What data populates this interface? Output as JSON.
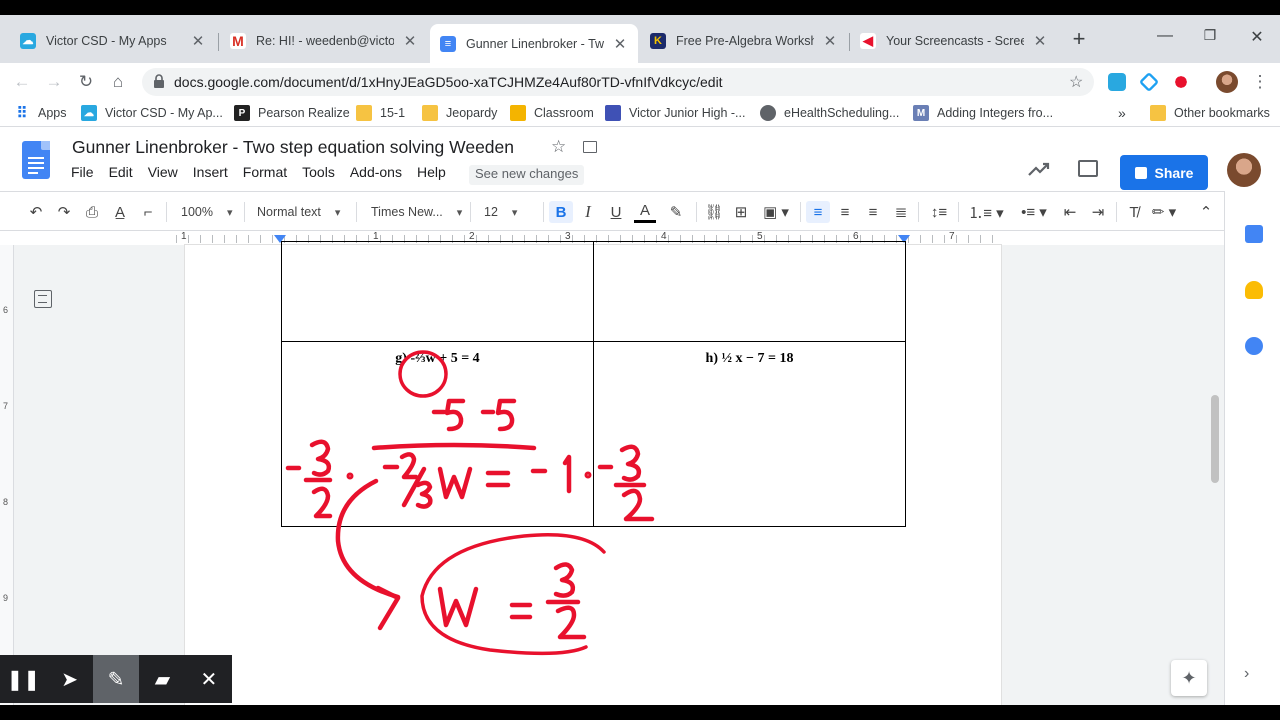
{
  "browser": {
    "tabs": [
      {
        "label": "Victor CSD - My Apps",
        "icon": "cloud-icon"
      },
      {
        "label": "Re: HI! - weedenb@victorsc",
        "icon": "gmail-icon"
      },
      {
        "label": "Gunner Linenbroker - Two s",
        "icon": "docs-icon"
      },
      {
        "label": "Free Pre-Algebra Workshee",
        "icon": "kuta-icon"
      },
      {
        "label": "Your Screencasts - Screenca",
        "icon": "screencastify-icon"
      }
    ],
    "url": "docs.google.com/document/d/1xHnyJEaGD5oo-xaTCJHMZe4Auf80rTD-vfnIfVdkcyc/edit",
    "bookmarks": [
      "Apps",
      "Victor CSD - My Ap...",
      "Pearson Realize",
      "15-1",
      "Jeopardy",
      "Classroom",
      "Victor Junior High -...",
      "eHealthScheduling...",
      "Adding Integers fro..."
    ],
    "bookmarks_more": "»",
    "other_bookmarks": "Other bookmarks"
  },
  "docs": {
    "title": "Gunner Linenbroker - Two step equation solving Weeden",
    "menu": [
      "File",
      "Edit",
      "View",
      "Insert",
      "Format",
      "Tools",
      "Add-ons",
      "Help"
    ],
    "see_changes": "See new changes",
    "share_label": "Share",
    "toolbar": {
      "zoom": "100%",
      "style": "Normal text",
      "font": "Times New...",
      "size": "12"
    },
    "ruler_numbers": [
      "1",
      "1",
      "2",
      "3",
      "4",
      "5",
      "6",
      "7"
    ],
    "vruler_numbers": [
      "6",
      "7",
      "8",
      "9"
    ]
  },
  "worksheet": {
    "problem_g": "g) -⅔w + 5 = 4",
    "problem_h": "h) ½ x  − 7 = 18"
  },
  "colors": {
    "ink": "#e8112d",
    "share": "#1a73e8",
    "docs_blue": "#4285f4"
  }
}
